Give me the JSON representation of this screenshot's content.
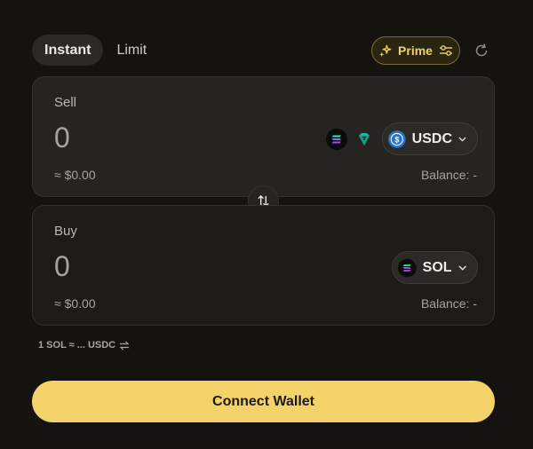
{
  "tabs": {
    "instant": "Instant",
    "limit": "Limit"
  },
  "prime": {
    "label": "Prime"
  },
  "sell": {
    "label": "Sell",
    "amount": "0",
    "usd": "≈ $0.00",
    "balance": "Balance: -",
    "token": "USDC"
  },
  "buy": {
    "label": "Buy",
    "amount": "0",
    "usd": "≈ $0.00",
    "balance": "Balance: -",
    "token": "SOL"
  },
  "rate": {
    "text": "1 SOL ≈ ... USDC"
  },
  "connect": {
    "label": "Connect Wallet"
  },
  "colors": {
    "accent": "#f2d269",
    "background": "#151310"
  }
}
